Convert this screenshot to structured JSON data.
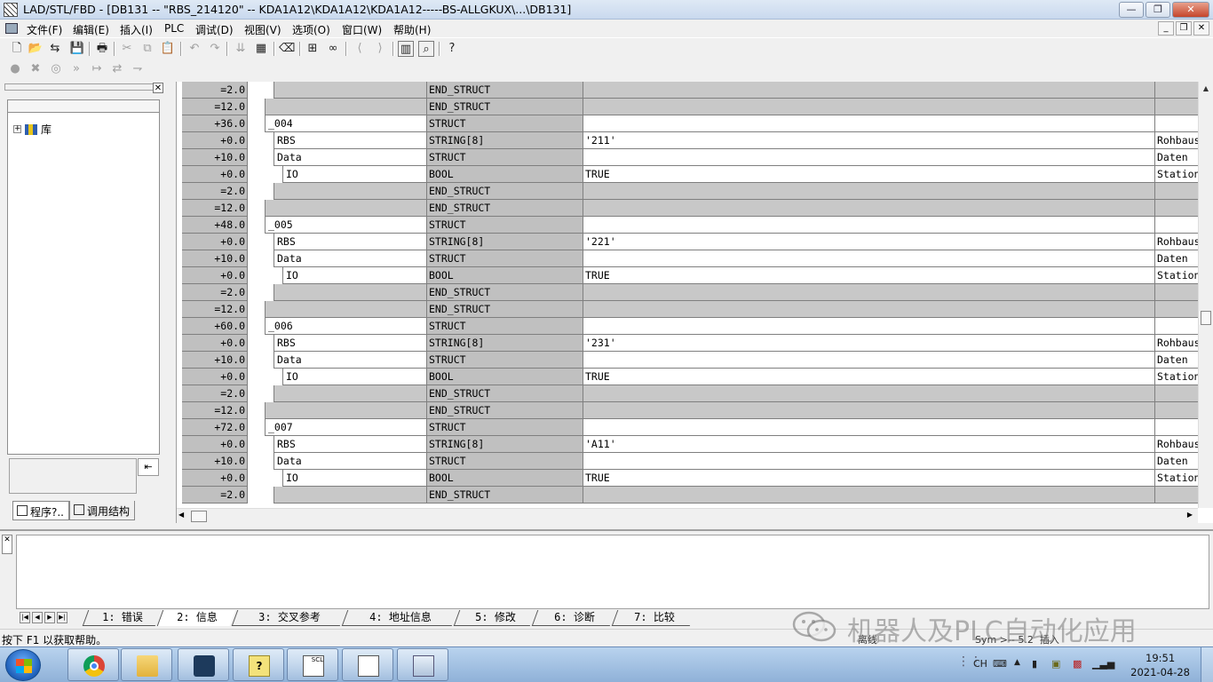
{
  "window": {
    "title": "LAD/STL/FBD  - [DB131 -- \"RBS_214120\" -- KDA1A12\\KDA1A12\\KDA1A12-----BS-ALLGKUX\\...\\DB131]"
  },
  "menu": [
    "文件(F)",
    "编辑(E)",
    "插入(I)",
    "PLC",
    "调试(D)",
    "视图(V)",
    "选项(O)",
    "窗口(W)",
    "帮助(H)"
  ],
  "left_panel": {
    "tree_root": "库",
    "tabs": [
      "程序?..",
      "调用结构"
    ]
  },
  "db_rows": [
    {
      "addr": "=2.0",
      "level": 1,
      "name": "",
      "type": "END_STRUCT",
      "init": "",
      "comment": "",
      "shade": "g"
    },
    {
      "addr": "=12.0",
      "level": 0,
      "name": "",
      "type": "END_STRUCT",
      "init": "",
      "comment": "",
      "shade": "g"
    },
    {
      "addr": "+36.0",
      "level": 0,
      "name": "_004",
      "type": "STRUCT",
      "init": "",
      "comment": "",
      "shade": "w"
    },
    {
      "addr": "+0.0",
      "level": 1,
      "name": "RBS",
      "type": "STRING[8]",
      "init": "'211'",
      "comment": "Rohbaus",
      "shade": "w"
    },
    {
      "addr": "+10.0",
      "level": 1,
      "name": "Data",
      "type": "STRUCT",
      "init": "",
      "comment": "Daten",
      "shade": "w"
    },
    {
      "addr": "+0.0",
      "level": 2,
      "name": "IO",
      "type": "BOOL",
      "init": "TRUE",
      "comment": "Station",
      "shade": "w"
    },
    {
      "addr": "=2.0",
      "level": 1,
      "name": "",
      "type": "END_STRUCT",
      "init": "",
      "comment": "",
      "shade": "g"
    },
    {
      "addr": "=12.0",
      "level": 0,
      "name": "",
      "type": "END_STRUCT",
      "init": "",
      "comment": "",
      "shade": "g"
    },
    {
      "addr": "+48.0",
      "level": 0,
      "name": "_005",
      "type": "STRUCT",
      "init": "",
      "comment": "",
      "shade": "w"
    },
    {
      "addr": "+0.0",
      "level": 1,
      "name": "RBS",
      "type": "STRING[8]",
      "init": "'221'",
      "comment": "Rohbaus",
      "shade": "w"
    },
    {
      "addr": "+10.0",
      "level": 1,
      "name": "Data",
      "type": "STRUCT",
      "init": "",
      "comment": "Daten",
      "shade": "w"
    },
    {
      "addr": "+0.0",
      "level": 2,
      "name": "IO",
      "type": "BOOL",
      "init": "TRUE",
      "comment": "Station",
      "shade": "w"
    },
    {
      "addr": "=2.0",
      "level": 1,
      "name": "",
      "type": "END_STRUCT",
      "init": "",
      "comment": "",
      "shade": "g"
    },
    {
      "addr": "=12.0",
      "level": 0,
      "name": "",
      "type": "END_STRUCT",
      "init": "",
      "comment": "",
      "shade": "g"
    },
    {
      "addr": "+60.0",
      "level": 0,
      "name": "_006",
      "type": "STRUCT",
      "init": "",
      "comment": "",
      "shade": "w"
    },
    {
      "addr": "+0.0",
      "level": 1,
      "name": "RBS",
      "type": "STRING[8]",
      "init": "'231'",
      "comment": "Rohbaus",
      "shade": "w"
    },
    {
      "addr": "+10.0",
      "level": 1,
      "name": "Data",
      "type": "STRUCT",
      "init": "",
      "comment": "Daten",
      "shade": "w"
    },
    {
      "addr": "+0.0",
      "level": 2,
      "name": "IO",
      "type": "BOOL",
      "init": "TRUE",
      "comment": "Station",
      "shade": "w"
    },
    {
      "addr": "=2.0",
      "level": 1,
      "name": "",
      "type": "END_STRUCT",
      "init": "",
      "comment": "",
      "shade": "g"
    },
    {
      "addr": "=12.0",
      "level": 0,
      "name": "",
      "type": "END_STRUCT",
      "init": "",
      "comment": "",
      "shade": "g"
    },
    {
      "addr": "+72.0",
      "level": 0,
      "name": "_007",
      "type": "STRUCT",
      "init": "",
      "comment": "",
      "shade": "w"
    },
    {
      "addr": "+0.0",
      "level": 1,
      "name": "RBS",
      "type": "STRING[8]",
      "init": "'A11'",
      "comment": "Rohbaus",
      "shade": "w"
    },
    {
      "addr": "+10.0",
      "level": 1,
      "name": "Data",
      "type": "STRUCT",
      "init": "",
      "comment": "Daten",
      "shade": "w"
    },
    {
      "addr": "+0.0",
      "level": 2,
      "name": "IO",
      "type": "BOOL",
      "init": "TRUE",
      "comment": "Station",
      "shade": "w"
    },
    {
      "addr": "=2.0",
      "level": 1,
      "name": "",
      "type": "END_STRUCT",
      "init": "",
      "comment": "",
      "shade": "g"
    }
  ],
  "bottom_tabs": [
    "1: 错误",
    "2: 信息",
    "3: 交叉参考",
    "4: 地址信息",
    "5: 修改",
    "6: 诊断",
    "7: 比较"
  ],
  "status": {
    "help_text": "按下 F1 以获取帮助。",
    "offline": "离线",
    "sym": "Sym >-- 5.2",
    "mode": "插入"
  },
  "watermark": "机器人及PLC自动化应用",
  "tray": {
    "lang": "CH",
    "time": "19:51",
    "date": "2021-04-28"
  }
}
